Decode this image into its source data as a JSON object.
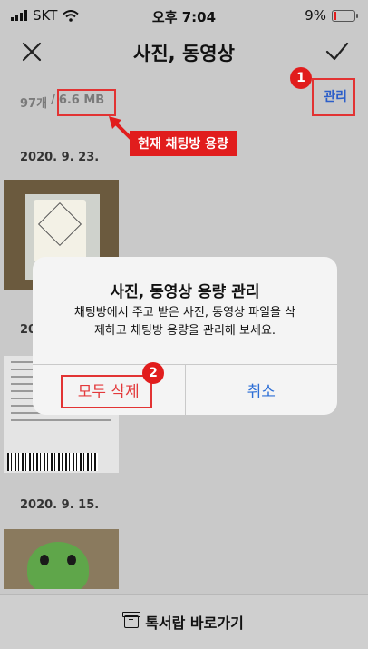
{
  "status_bar": {
    "carrier": "SKT",
    "time": "오후 7:04",
    "battery": "9%",
    "battery_level": 0.09,
    "battery_color": "#e21b1b"
  },
  "header": {
    "title": "사진, 동영상",
    "close_icon": "close-icon",
    "confirm_icon": "checkmark-icon"
  },
  "summary": {
    "count": "97개",
    "separator": "/",
    "size": "6.6 MB"
  },
  "manage_label": "관리",
  "annotations": {
    "badge_1": "1",
    "badge_2": "2",
    "size_callout": "현재 채팅방 용량",
    "highlight_color": "#e23333"
  },
  "sections": [
    {
      "date": "2020. 9. 23."
    },
    {
      "date": "2020"
    },
    {
      "date": "2020. 9. 15."
    }
  ],
  "dialog": {
    "title": "사진, 동영상 용량 관리",
    "message_line1": "채팅방에서 주고 받은 사진, 동영상 파일을 삭",
    "message_line2": "제하고 채팅방 용량을 관리해 보세요.",
    "delete_all": "모두 삭제",
    "cancel": "취소",
    "delete_color": "#e3393b",
    "cancel_color": "#2e6fd6"
  },
  "bottom": {
    "drawer_label": "톡서랍 바로가기",
    "icon": "drawer-box-icon"
  }
}
